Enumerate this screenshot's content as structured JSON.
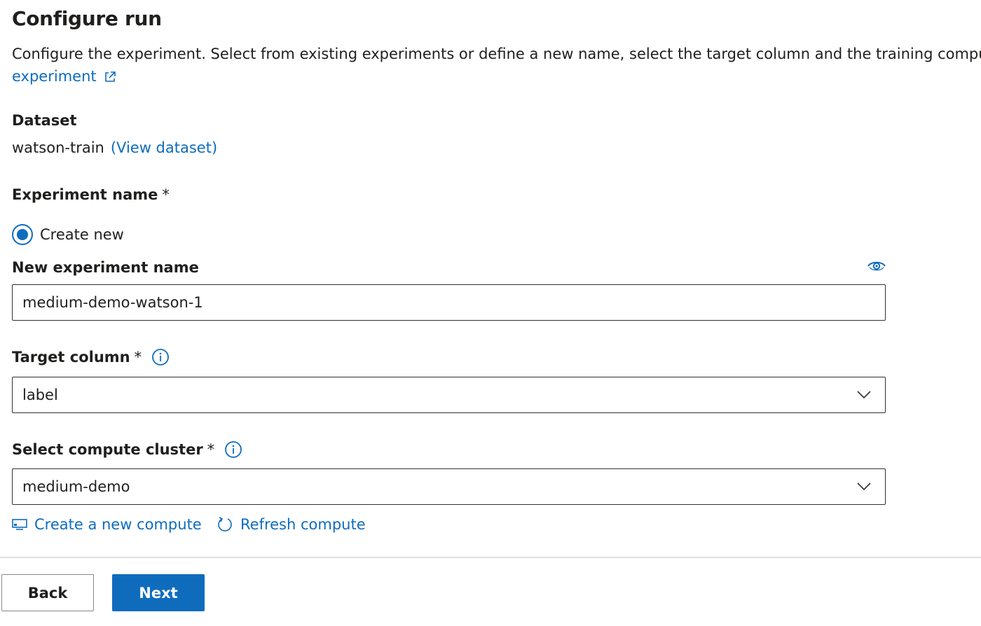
{
  "header": {
    "title": "Configure run",
    "description": "Configure the experiment. Select from existing experiments or define a new name, select the target column and the training compute to use. Learn more on how to configure the",
    "learn_more_link": "experiment"
  },
  "dataset": {
    "label": "Dataset",
    "name": "watson-train",
    "view_link": "(View dataset)"
  },
  "experiment": {
    "label": "Experiment name",
    "required_mark": "*",
    "option_create_new": "Create new",
    "new_name_label": "New experiment name",
    "new_name_value": "medium-demo-watson-1"
  },
  "target_column": {
    "label": "Target column",
    "required_mark": "*",
    "selected": "label"
  },
  "compute": {
    "label": "Select compute cluster",
    "required_mark": "*",
    "selected": "medium-demo",
    "create_link": "Create a new compute",
    "refresh_link": "Refresh compute"
  },
  "footer": {
    "back_label": "Back",
    "next_label": "Next"
  },
  "icons": {
    "external_link": "external-link-icon",
    "eye": "eye-icon",
    "info": "info-icon",
    "chevron": "chevron-down-icon",
    "compute": "computer-icon",
    "refresh": "refresh-icon"
  },
  "colors": {
    "accent": "#0f6cbd",
    "text": "#201f1e",
    "border": "#323130",
    "divider": "#e1dfdd"
  }
}
